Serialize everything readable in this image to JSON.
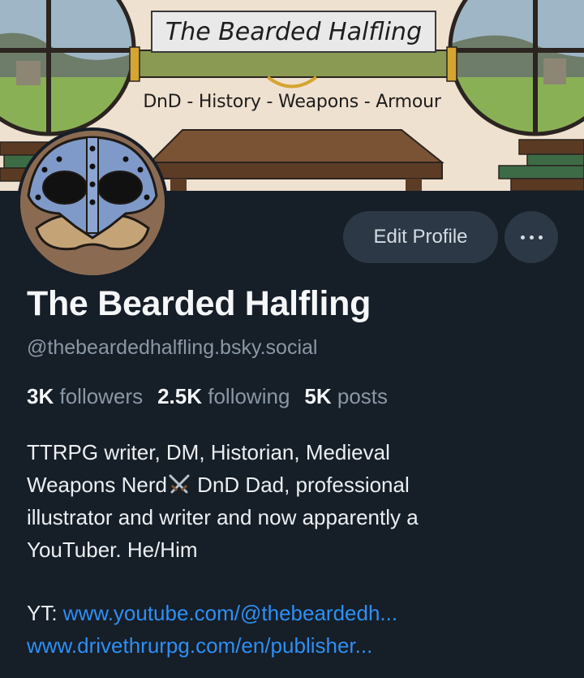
{
  "banner": {
    "title": "The Bearded Halfling",
    "subtitle": "DnD - History - Weapons - Armour"
  },
  "actions": {
    "edit_profile_label": "Edit Profile",
    "more_icon": "ellipsis-icon"
  },
  "profile": {
    "display_name": "The Bearded Halfling",
    "handle": "@thebeardedhalfling.bsky.social",
    "stats": {
      "followers_count": "3K",
      "followers_label": "followers",
      "following_count": "2.5K",
      "following_label": "following",
      "posts_count": "5K",
      "posts_label": "posts"
    },
    "bio_part1": "TTRPG writer, DM, Historian, Medieval\nWeapons Nerd",
    "bio_emoji": "crossed-swords-icon",
    "bio_part2": " DnD Dad, professional\nillustrator and writer and now apparently a\nYouTuber. He/Him",
    "links": {
      "yt_prefix": "YT: ",
      "yt_url": "www.youtube.com/@thebeardedh...",
      "drivethru_url": "www.drivethrurpg.com/en/publisher..."
    }
  },
  "colors": {
    "background": "#161e27",
    "button": "#2c3845",
    "muted_text": "#8a97a6",
    "link": "#2d8ff5"
  }
}
